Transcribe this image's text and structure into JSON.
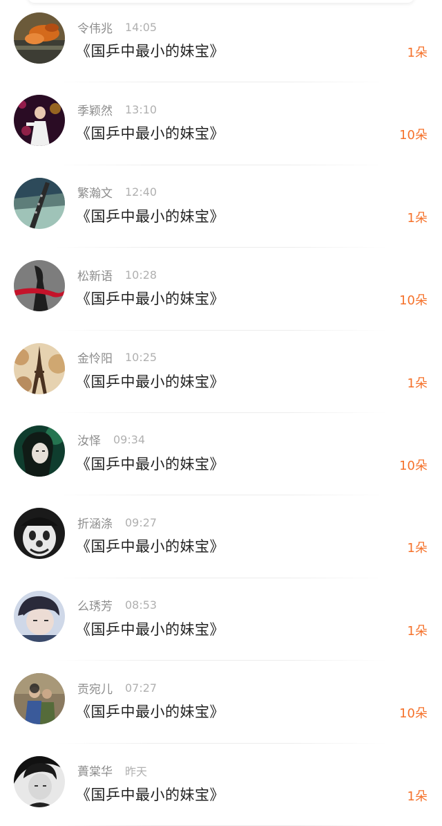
{
  "messages": [
    {
      "name": "令伟兆",
      "time": "14:05",
      "title": "《国乒中最小的妹宝》",
      "count": "1朵",
      "avatar_icon": "orange-koi-avatar",
      "avatar_colors": [
        "#6b5a3a",
        "#d46a1c"
      ]
    },
    {
      "name": "季颖然",
      "time": "13:10",
      "title": "《国乒中最小的妹宝》",
      "count": "10朵",
      "avatar_icon": "stage-performer-avatar",
      "avatar_colors": [
        "#3a1030",
        "#c0245c"
      ]
    },
    {
      "name": "繁瀚文",
      "time": "12:40",
      "title": "《国乒中最小的妹宝》",
      "count": "1朵",
      "avatar_icon": "flute-avatar",
      "avatar_colors": [
        "#2d4a5a",
        "#9fc3b8"
      ]
    },
    {
      "name": "松新语",
      "time": "10:28",
      "title": "《国乒中最小的妹宝》",
      "count": "10朵",
      "avatar_icon": "red-ribbon-avatar",
      "avatar_colors": [
        "#3a3a3a",
        "#c4132a"
      ]
    },
    {
      "name": "金怜阳",
      "time": "10:25",
      "title": "《国乒中最小的妹宝》",
      "count": "1朵",
      "avatar_icon": "eiffel-tower-avatar",
      "avatar_colors": [
        "#d9b98a",
        "#5a3a20"
      ]
    },
    {
      "name": "汝怿",
      "time": "09:34",
      "title": "《国乒中最小的妹宝》",
      "count": "10朵",
      "avatar_icon": "green-portrait-avatar",
      "avatar_colors": [
        "#0f3d2e",
        "#2f8c5f"
      ]
    },
    {
      "name": "折涵涤",
      "time": "09:27",
      "title": "《国乒中最小的妹宝》",
      "count": "1朵",
      "avatar_icon": "clown-face-avatar",
      "avatar_colors": [
        "#1a1a1a",
        "#e8e8e8"
      ]
    },
    {
      "name": "么琇芳",
      "time": "08:53",
      "title": "《国乒中最小的妹宝》",
      "count": "1朵",
      "avatar_icon": "young-man-avatar",
      "avatar_colors": [
        "#2a2a3a",
        "#cfd8e8"
      ]
    },
    {
      "name": "贡宛儿",
      "time": "07:27",
      "title": "《国乒中最小的妹宝》",
      "count": "10朵",
      "avatar_icon": "family-photo-avatar",
      "avatar_colors": [
        "#7a6a50",
        "#3a5a9a"
      ]
    },
    {
      "name": "蕢棠华",
      "time": "昨天",
      "title": "《国乒中最小的妹宝》",
      "count": "1朵",
      "avatar_icon": "monochrome-portrait-avatar",
      "avatar_colors": [
        "#111111",
        "#d0d0d0"
      ]
    }
  ],
  "accent_color": "#f5712a"
}
